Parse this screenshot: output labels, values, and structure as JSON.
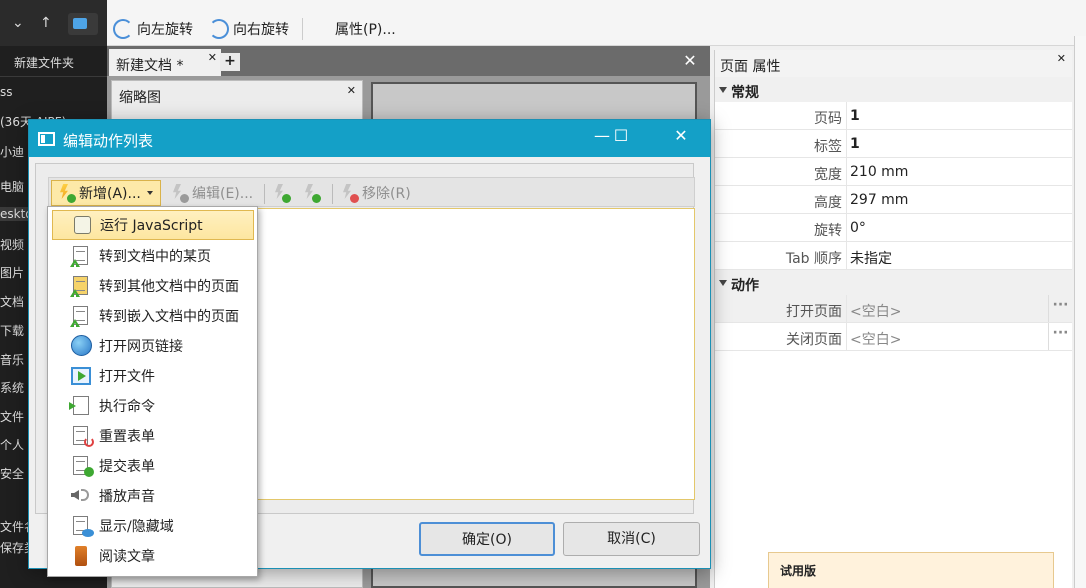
{
  "explorer": {
    "new_folder": "新建文件夹",
    "items": [
      {
        "label": "ss"
      },
      {
        "label": "(36天 AIPF)"
      },
      {
        "label": "小迪"
      },
      {
        "label": "电脑"
      },
      {
        "label": "esktop"
      },
      {
        "label": "视频"
      },
      {
        "label": "图片"
      },
      {
        "label": "文档"
      },
      {
        "label": "下载"
      },
      {
        "label": "音乐"
      },
      {
        "label": "系统 (C"
      },
      {
        "label": "文件 (D"
      },
      {
        "label": "个人 (E"
      },
      {
        "label": "安全 (F"
      },
      {
        "label": "文件名"
      },
      {
        "label": "保存类型"
      }
    ]
  },
  "toolbar": {
    "rotate_left": "向左旋转",
    "rotate_right": "向右旋转",
    "properties": "属性(P)..."
  },
  "document": {
    "tab_label": "新建文档 *",
    "thumbnail_title": "缩略图"
  },
  "properties_panel": {
    "title": "页面 属性",
    "general_category": "常规",
    "general_rows": [
      {
        "key": "页码",
        "value": "1"
      },
      {
        "key": "标签",
        "value": "1"
      },
      {
        "key": "宽度",
        "value": "210 mm"
      },
      {
        "key": "高度",
        "value": "297 mm"
      },
      {
        "key": "旋转",
        "value": "0°"
      },
      {
        "key": "Tab 顺序",
        "value": "未指定"
      }
    ],
    "action_category": "动作",
    "action_rows": [
      {
        "key": "打开页面",
        "value": "<空白>"
      },
      {
        "key": "关闭页面",
        "value": "<空白>"
      }
    ],
    "trial": "试用版"
  },
  "dialog": {
    "title": "编辑动作列表",
    "new_btn": "新增(A)...",
    "edit_btn": "编辑(E)...",
    "remove_btn": "移除(R)",
    "ok_btn": "确定(O)",
    "cancel_btn": "取消(C)"
  },
  "menu": {
    "items": [
      {
        "label": "运行 JavaScript"
      },
      {
        "label": "转到文档中的某页"
      },
      {
        "label": "转到其他文档中的页面"
      },
      {
        "label": "转到嵌入文档中的页面"
      },
      {
        "label": "打开网页链接"
      },
      {
        "label": "打开文件"
      },
      {
        "label": "执行命令"
      },
      {
        "label": "重置表单"
      },
      {
        "label": "提交表单"
      },
      {
        "label": "播放声音"
      },
      {
        "label": "显示/隐藏域"
      },
      {
        "label": "阅读文章"
      }
    ]
  }
}
